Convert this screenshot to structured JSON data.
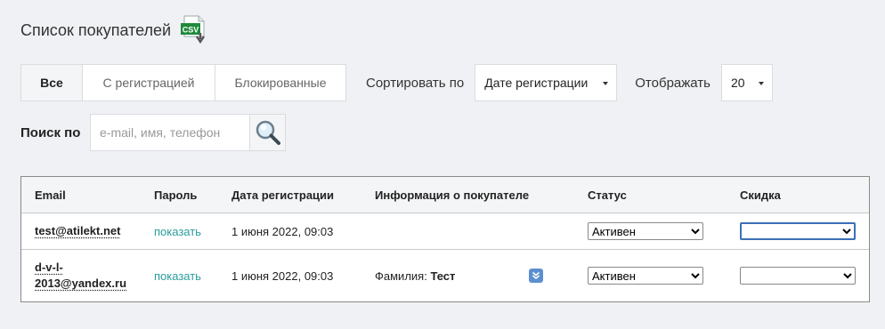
{
  "page": {
    "title": "Список покупателей",
    "csv_icon_text": "CSV"
  },
  "tabs": [
    {
      "label": "Все",
      "active": true
    },
    {
      "label": "С регистрацией",
      "active": false
    },
    {
      "label": "Блокированные",
      "active": false
    }
  ],
  "sort": {
    "label": "Сортировать по",
    "value": "Дате регистрации"
  },
  "display": {
    "label": "Отображать",
    "value": "20"
  },
  "search": {
    "label": "Поиск по",
    "placeholder": "e-mail, имя, телефон",
    "value": ""
  },
  "table": {
    "headers": {
      "email": "Email",
      "password": "Пароль",
      "reg_date": "Дата регистрации",
      "info": "Информация о покупателе",
      "status": "Статус",
      "discount": "Скидка"
    },
    "rows": [
      {
        "email": "test@atilekt.net",
        "password_link": "показать",
        "reg_date": "1 июня 2022, 09:03",
        "info_label": "",
        "info_value": "",
        "status": "Активен",
        "discount": ""
      },
      {
        "email_line1": "d-v-l-",
        "email_line2": "2013@yandex.ru",
        "password_link": "показать",
        "reg_date": "1 июня 2022, 09:03",
        "info_label": "Фамилия:",
        "info_value": "Тест",
        "status": "Активен",
        "discount": ""
      }
    ]
  },
  "colors": {
    "background": "#f0f1f4",
    "link": "#2a9d9d",
    "expand_button": "#5b8fd0",
    "csv_green": "#1f8a3b"
  }
}
